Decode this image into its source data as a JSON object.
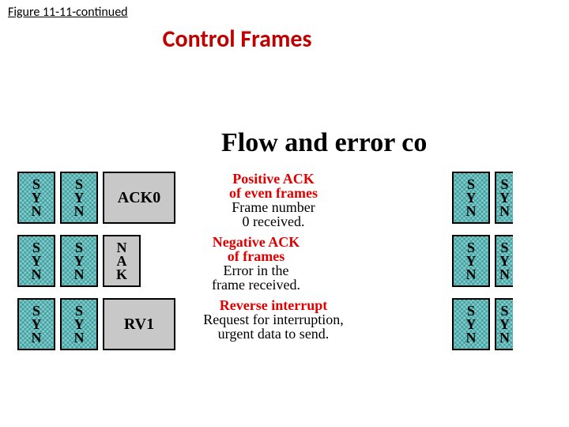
{
  "figure_caption": "Figure 11-11-continued",
  "title": "Control Frames",
  "section_heading": "Flow and error co",
  "syn_letters": {
    "a": "S",
    "b": "Y",
    "c": "N"
  },
  "rows": [
    {
      "code": "ACK0",
      "code_vertical": null,
      "red1": "Positive ACK",
      "red2": "of even frames",
      "blk1": "Frame number",
      "blk2": "0 received."
    },
    {
      "code": null,
      "code_vertical": {
        "a": "N",
        "b": "A",
        "c": "K"
      },
      "red1": "Negative ACK",
      "red2": "of frames",
      "blk1": "Error in the",
      "blk2": "frame received."
    },
    {
      "code": "RV1",
      "code_vertical": null,
      "red1": "Reverse interrupt",
      "red2": "",
      "blk1": "Request for interruption,",
      "blk2": "urgent data to send."
    }
  ]
}
